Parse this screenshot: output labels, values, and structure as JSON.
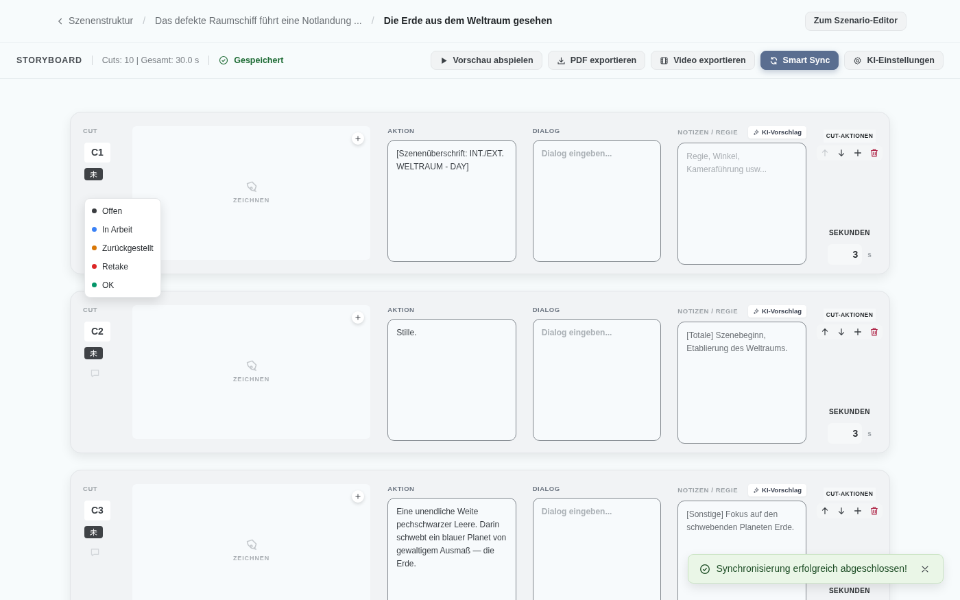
{
  "breadcrumb": [
    {
      "label": "Szenenstruktur",
      "current": false
    },
    {
      "separator": "/",
      "label": "Das defekte Raumschiff führt eine Notlandung ...",
      "current": false
    },
    {
      "separator": "/",
      "label": "Die Erde aus dem Weltraum gesehen",
      "current": true
    }
  ],
  "header_button": "Zum Szenario-Editor",
  "toolbar": {
    "title": "STORYBOARD",
    "stats": "Cuts: 10 | Gesamt: 30.0 s",
    "saved": "Gespeichert",
    "buttons": [
      {
        "label": "Vorschau abspielen",
        "kind": "play",
        "primary": false
      },
      {
        "label": "PDF exportieren",
        "kind": "download",
        "primary": false
      },
      {
        "label": "Video exportieren",
        "kind": "film",
        "primary": false
      },
      {
        "label": "Smart Sync",
        "kind": "sync",
        "primary": true
      },
      {
        "label": "KI-Einstellungen",
        "kind": "gear",
        "primary": false
      }
    ]
  },
  "cuts": [
    {
      "cut_label": "CUT",
      "id": "C1",
      "status": "未",
      "draw_label": "ZEICHNEN",
      "aktion_label": "AKTION",
      "aktion_text": "[Szenenüberschrift: INT./EXT. WELTRAUM - DAY]",
      "dialog_label": "DIALOG",
      "dialog_placeholder": "Dialog eingeben...",
      "notes_label": "NOTIZEN / REGIE",
      "notes_placeholder": "Regie, Winkel, Kameraführung usw...",
      "ki_button": "KI-Vorschlag",
      "actions_label": "CUT-AKTIONEN",
      "up_disabled": true,
      "seconds_label": "SEKUNDEN",
      "seconds": "3",
      "unit": "s",
      "status_menu": [
        {
          "label": "Offen",
          "color": "#3a3d40"
        },
        {
          "label": "In Arbeit",
          "color": "#3b82f6"
        },
        {
          "label": "Zurückgestellt",
          "color": "#d97706"
        },
        {
          "label": "Retake",
          "color": "#dc2626"
        },
        {
          "label": "OK",
          "color": "#059669"
        }
      ]
    },
    {
      "cut_label": "CUT",
      "id": "C2",
      "status": "未",
      "draw_label": "ZEICHNEN",
      "aktion_label": "AKTION",
      "aktion_text": "Stille.",
      "dialog_label": "DIALOG",
      "dialog_placeholder": "Dialog eingeben...",
      "notes_label": "NOTIZEN / REGIE",
      "notes_text": "[Totale] Szenebeginn, Etablierung des Weltraums.",
      "ki_button": "KI-Vorschlag",
      "actions_label": "CUT-AKTIONEN",
      "up_disabled": false,
      "seconds_label": "SEKUNDEN",
      "seconds": "3",
      "unit": "s"
    },
    {
      "cut_label": "CUT",
      "id": "C3",
      "status": "未",
      "draw_label": "ZEICHNEN",
      "aktion_label": "AKTION",
      "aktion_text": "Eine unendliche Weite pechschwarzer Leere. Darin schwebt ein blauer Planet von gewaltigem Ausmaß — die Erde.",
      "dialog_label": "DIALOG",
      "dialog_placeholder": "Dialog eingeben...",
      "notes_label": "NOTIZEN / REGIE",
      "notes_text": "[Sonstige] Fokus auf den schwebenden Planeten Erde.",
      "ki_button": "KI-Vorschlag",
      "actions_label": "CUT-AKTIONEN",
      "up_disabled": false,
      "seconds_label": "SEKUNDEN"
    }
  ],
  "toast": {
    "text": "Synchronisierung erfolgreich abgeschlossen!"
  }
}
